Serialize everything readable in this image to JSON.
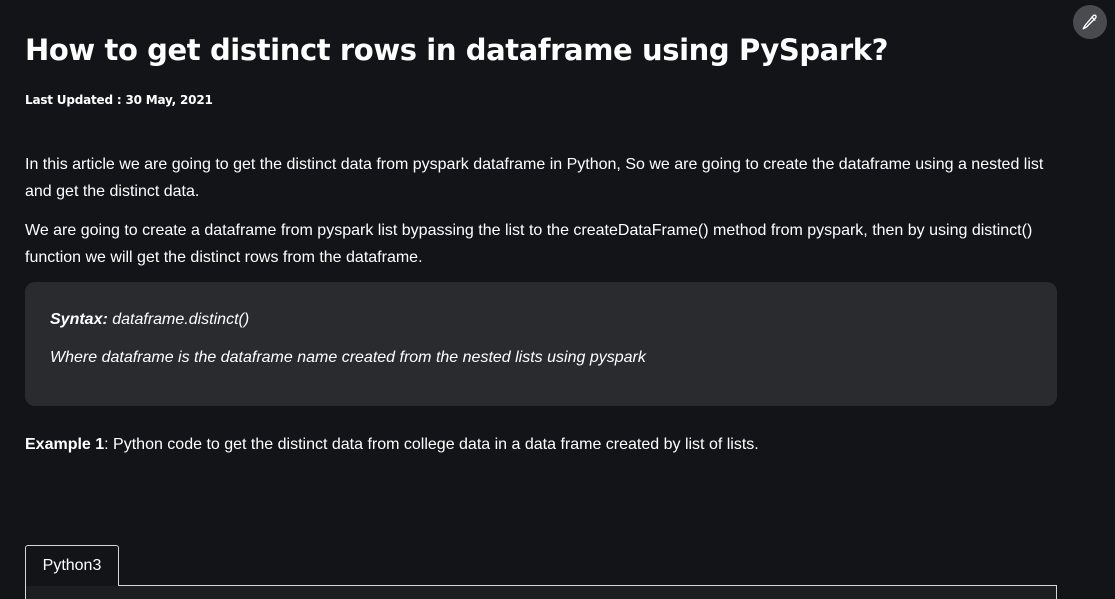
{
  "article": {
    "title": "How to get distinct rows in dataframe using PySpark?",
    "last_updated": "Last Updated : 30 May, 2021",
    "paragraphs": [
      "In this article we are going to get the distinct data from pyspark dataframe in Python, So we are going to create the dataframe using a nested list and get the distinct data.",
      "We are going to create a dataframe from pyspark list bypassing the list to the createDataFrame() method from pyspark, then by using distinct() function we will get the distinct rows from the dataframe."
    ],
    "syntax_box": {
      "label": "Syntax:",
      "code": " dataframe.distinct()",
      "description": "Where dataframe is the dataframe name created from the nested lists using pyspark"
    },
    "example": {
      "label": "Example 1",
      "text": ": Python code to get the distinct data from college data in a data frame created by list of lists."
    },
    "code_tabs": [
      "Python3"
    ]
  },
  "toolbar": {
    "edit_icon": "pencil-icon"
  },
  "colors": {
    "background": "#131417",
    "syntax_box_background": "#2a2b2f",
    "edit_button_background": "#4a4b50",
    "text": "#ffffff",
    "tab_border": "#d6d6d6"
  }
}
